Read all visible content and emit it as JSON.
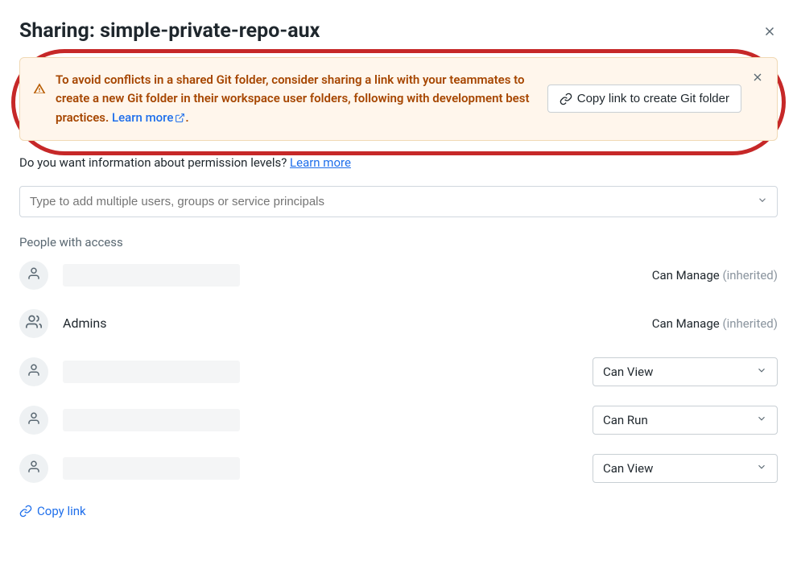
{
  "title": "Sharing: simple-private-repo-aux",
  "banner": {
    "text": "To avoid conflicts in a shared Git folder, consider sharing a link with your teammates to create a new Git folder in their workspace user folders, following with development best practices. ",
    "learn_more": "Learn more",
    "period": ".",
    "button": "Copy link to create Git folder"
  },
  "permission_info": {
    "question": "Do you want information about permission levels? ",
    "link": "Learn more"
  },
  "user_input_placeholder": "Type to add multiple users, groups or service principals",
  "section_label": "People with access",
  "access": [
    {
      "type": "user",
      "name": "",
      "permission": "Can Manage",
      "inherited": true,
      "editable": false
    },
    {
      "type": "group",
      "name": "Admins",
      "permission": "Can Manage",
      "inherited": true,
      "editable": false
    },
    {
      "type": "user",
      "name": "",
      "permission": "Can View",
      "inherited": false,
      "editable": true
    },
    {
      "type": "user",
      "name": "",
      "permission": "Can Run",
      "inherited": false,
      "editable": true
    },
    {
      "type": "user",
      "name": "",
      "permission": "Can View",
      "inherited": false,
      "editable": true
    }
  ],
  "inherited_label": "(inherited)",
  "footer": {
    "copy_link": "Copy link"
  }
}
